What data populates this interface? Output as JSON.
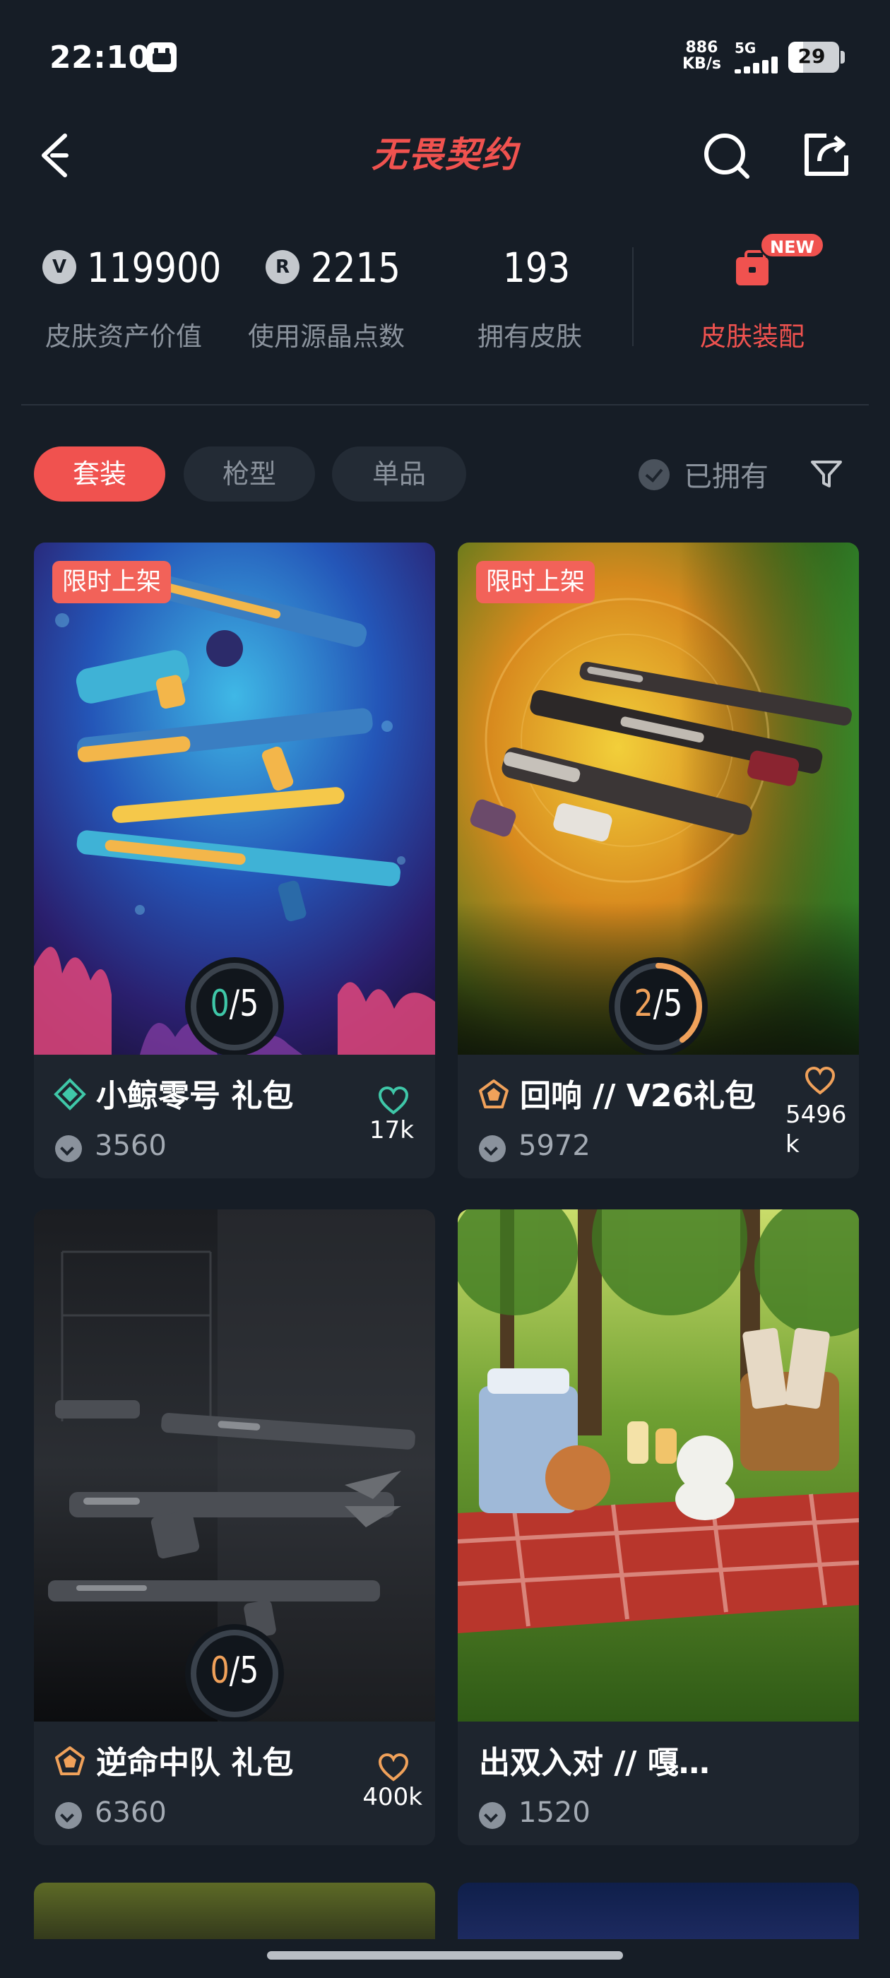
{
  "status_bar": {
    "time": "22:10",
    "net_speed_value": "886",
    "net_speed_unit": "KB/s",
    "network": "5G",
    "battery": "29",
    "battery_level": 0.29
  },
  "header": {
    "title": "无畏契约",
    "back_icon": "chevron-left-icon",
    "search_icon": "search-icon",
    "share_icon": "share-icon"
  },
  "stats": [
    {
      "value": "119900",
      "label": "皮肤资产价值",
      "icon": "vp-coin-icon"
    },
    {
      "value": "2215",
      "label": "使用源晶点数",
      "icon": "radianite-icon"
    },
    {
      "value": "193",
      "label": "拥有皮肤"
    }
  ],
  "loadout": {
    "label": "皮肤装配",
    "badge": "NEW",
    "icon": "bag-icon"
  },
  "filters": {
    "tabs": [
      "套装",
      "枪型",
      "单品"
    ],
    "active_index": 0,
    "owned_label": "已拥有",
    "owned_checked": false,
    "filter_icon": "funnel-icon"
  },
  "cards": [
    {
      "tag": "限时上架",
      "title": "小鲸零号 礼包",
      "price": "3560",
      "likes": "17k",
      "owned": "0",
      "total": "5",
      "owned_count": 0,
      "tier_icon": "tier-diamond-icon",
      "tier_color": "#3fc7a8",
      "heart_color": "#3fc7a8",
      "progress_color": "#3fc7a8"
    },
    {
      "tag": "限时上架",
      "title": "回响 // V26礼包",
      "price": "5972",
      "likes": "5496\nk",
      "owned": "2",
      "total": "5",
      "owned_count": 2,
      "tier_icon": "tier-pentagon-icon",
      "tier_color": "#f0a15a",
      "heart_color": "#f0a15a",
      "progress_color": "#f0a15a"
    },
    {
      "tag": "",
      "title": "逆命中队 礼包",
      "price": "6360",
      "likes": "400k",
      "owned": "0",
      "total": "5",
      "owned_count": 0,
      "tier_icon": "tier-pentagon-icon",
      "tier_color": "#f0a15a",
      "heart_color": "#f0a15a",
      "progress_color": "#f0a15a"
    },
    {
      "tag": "",
      "title": "出双入对 // 嘎…",
      "price": "1520",
      "likes": "",
      "owned": "",
      "total": "",
      "owned_count": 0
    }
  ]
}
